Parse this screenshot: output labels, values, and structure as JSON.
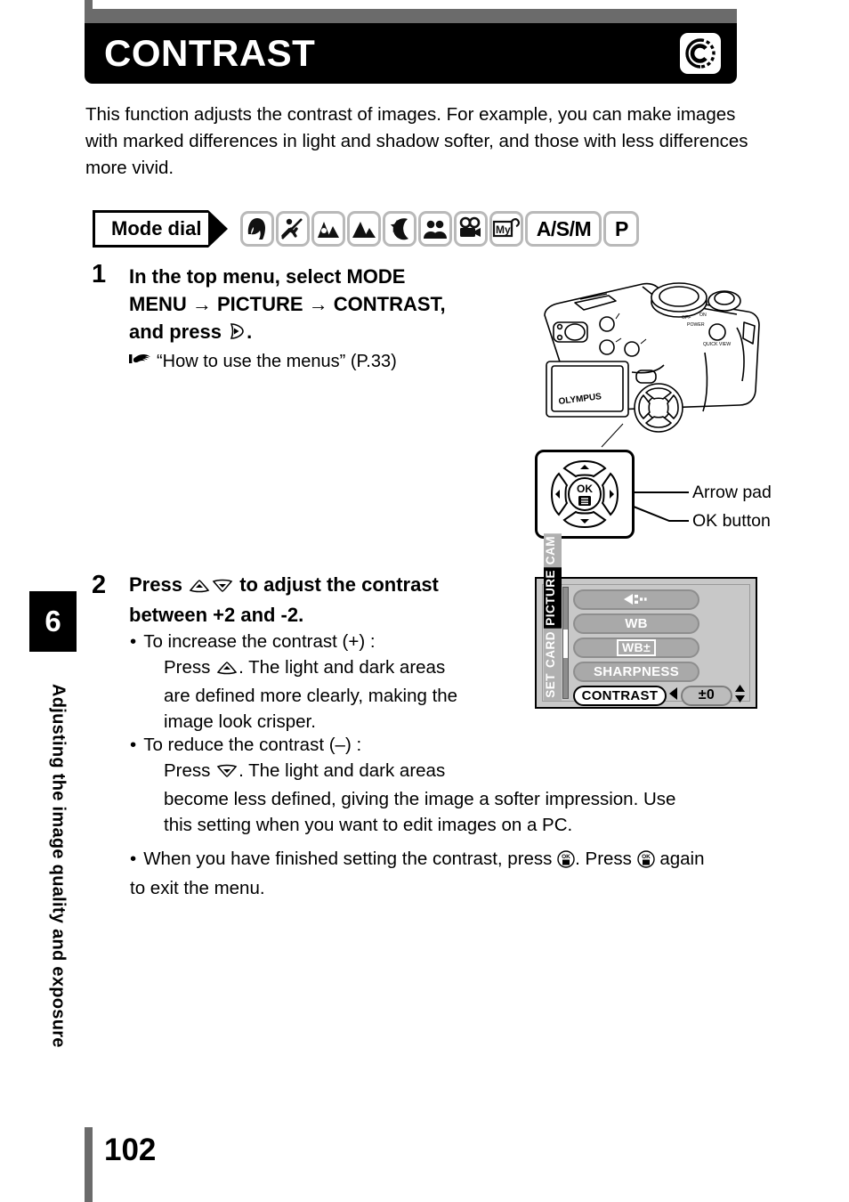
{
  "header": {
    "title": "CONTRAST",
    "badge_icon": "copyright-c-icon",
    "badge_letter": "C"
  },
  "intro": {
    "paragraph": "This function adjusts the contrast of images. For example, you can make images with marked differences in light and shadow softer, and those with less differences more vivid."
  },
  "mode_dial": {
    "label": "Mode dial",
    "icons": [
      {
        "name": "portrait-mode-icon",
        "text": ""
      },
      {
        "name": "sports-mode-icon",
        "text": ""
      },
      {
        "name": "landscape-portrait-mode-icon",
        "text": ""
      },
      {
        "name": "landscape-mode-icon",
        "text": ""
      },
      {
        "name": "night-scene-mode-icon",
        "text": ""
      },
      {
        "name": "self-portrait-mode-icon",
        "text": ""
      },
      {
        "name": "movie-mode-icon",
        "text": ""
      },
      {
        "name": "my-mode-icon",
        "text": ""
      },
      {
        "name": "asm-mode-label",
        "text": "A/S/M"
      },
      {
        "name": "p-mode-label",
        "text": "P"
      }
    ]
  },
  "steps": [
    {
      "number": "1",
      "heading_line1": "In the top menu, select MODE",
      "heading_line2": "MENU → PICTURE → CONTRAST,",
      "heading_line3_pre": "and press",
      "heading_line3_post": ".",
      "reference": "“How to use the menus” (P.33)"
    },
    {
      "number": "2",
      "heading_line1_pre": "Press",
      "heading_line1_post": "to adjust the contrast",
      "heading_line2": "between +2 and -2.",
      "bullets": [
        {
          "label": "To increase the contrast (+) :",
          "body_pre": "Press",
          "body_post": ". The light and dark areas",
          "body_rest_line1": "are defined more clearly, making the",
          "body_rest_line2": "image look crisper."
        },
        {
          "label": "To reduce the contrast (–) :",
          "body_pre": "Press",
          "body_post": ". The light and dark areas",
          "body_rest_line1": "become less defined, giving the image a softer impression. Use",
          "body_rest_line2": "this setting when you want to edit images on a PC."
        }
      ],
      "final_note_pre": "When you have finished setting the contrast, press",
      "final_note_mid": ". Press",
      "final_note_post": "again",
      "final_note_line2": "to exit the menu."
    }
  ],
  "camera_callouts": {
    "arrow_pad": "Arrow pad",
    "ok_button": "OK button",
    "camera_brand": "OLYMPUS"
  },
  "lcd": {
    "tabs": [
      {
        "label": "SET",
        "active": false
      },
      {
        "label": "CARD",
        "active": false
      },
      {
        "label": "PICTURE",
        "active": true
      },
      {
        "label": "CAM",
        "active": false
      }
    ],
    "items": [
      {
        "label": "",
        "icon": "image-quality-icon",
        "selected": false
      },
      {
        "label": "WB",
        "icon": "",
        "selected": false
      },
      {
        "label": "WB±",
        "icon": "white-balance-compensation-icon",
        "selected": false
      },
      {
        "label": "SHARPNESS",
        "icon": "",
        "selected": false
      },
      {
        "label": "CONTRAST",
        "icon": "",
        "selected": true
      }
    ],
    "value": "±0"
  },
  "sidebar": {
    "chapter_number": "6",
    "chapter_title": "Adjusting the image quality and exposure"
  },
  "footer": {
    "page_number": "102"
  }
}
